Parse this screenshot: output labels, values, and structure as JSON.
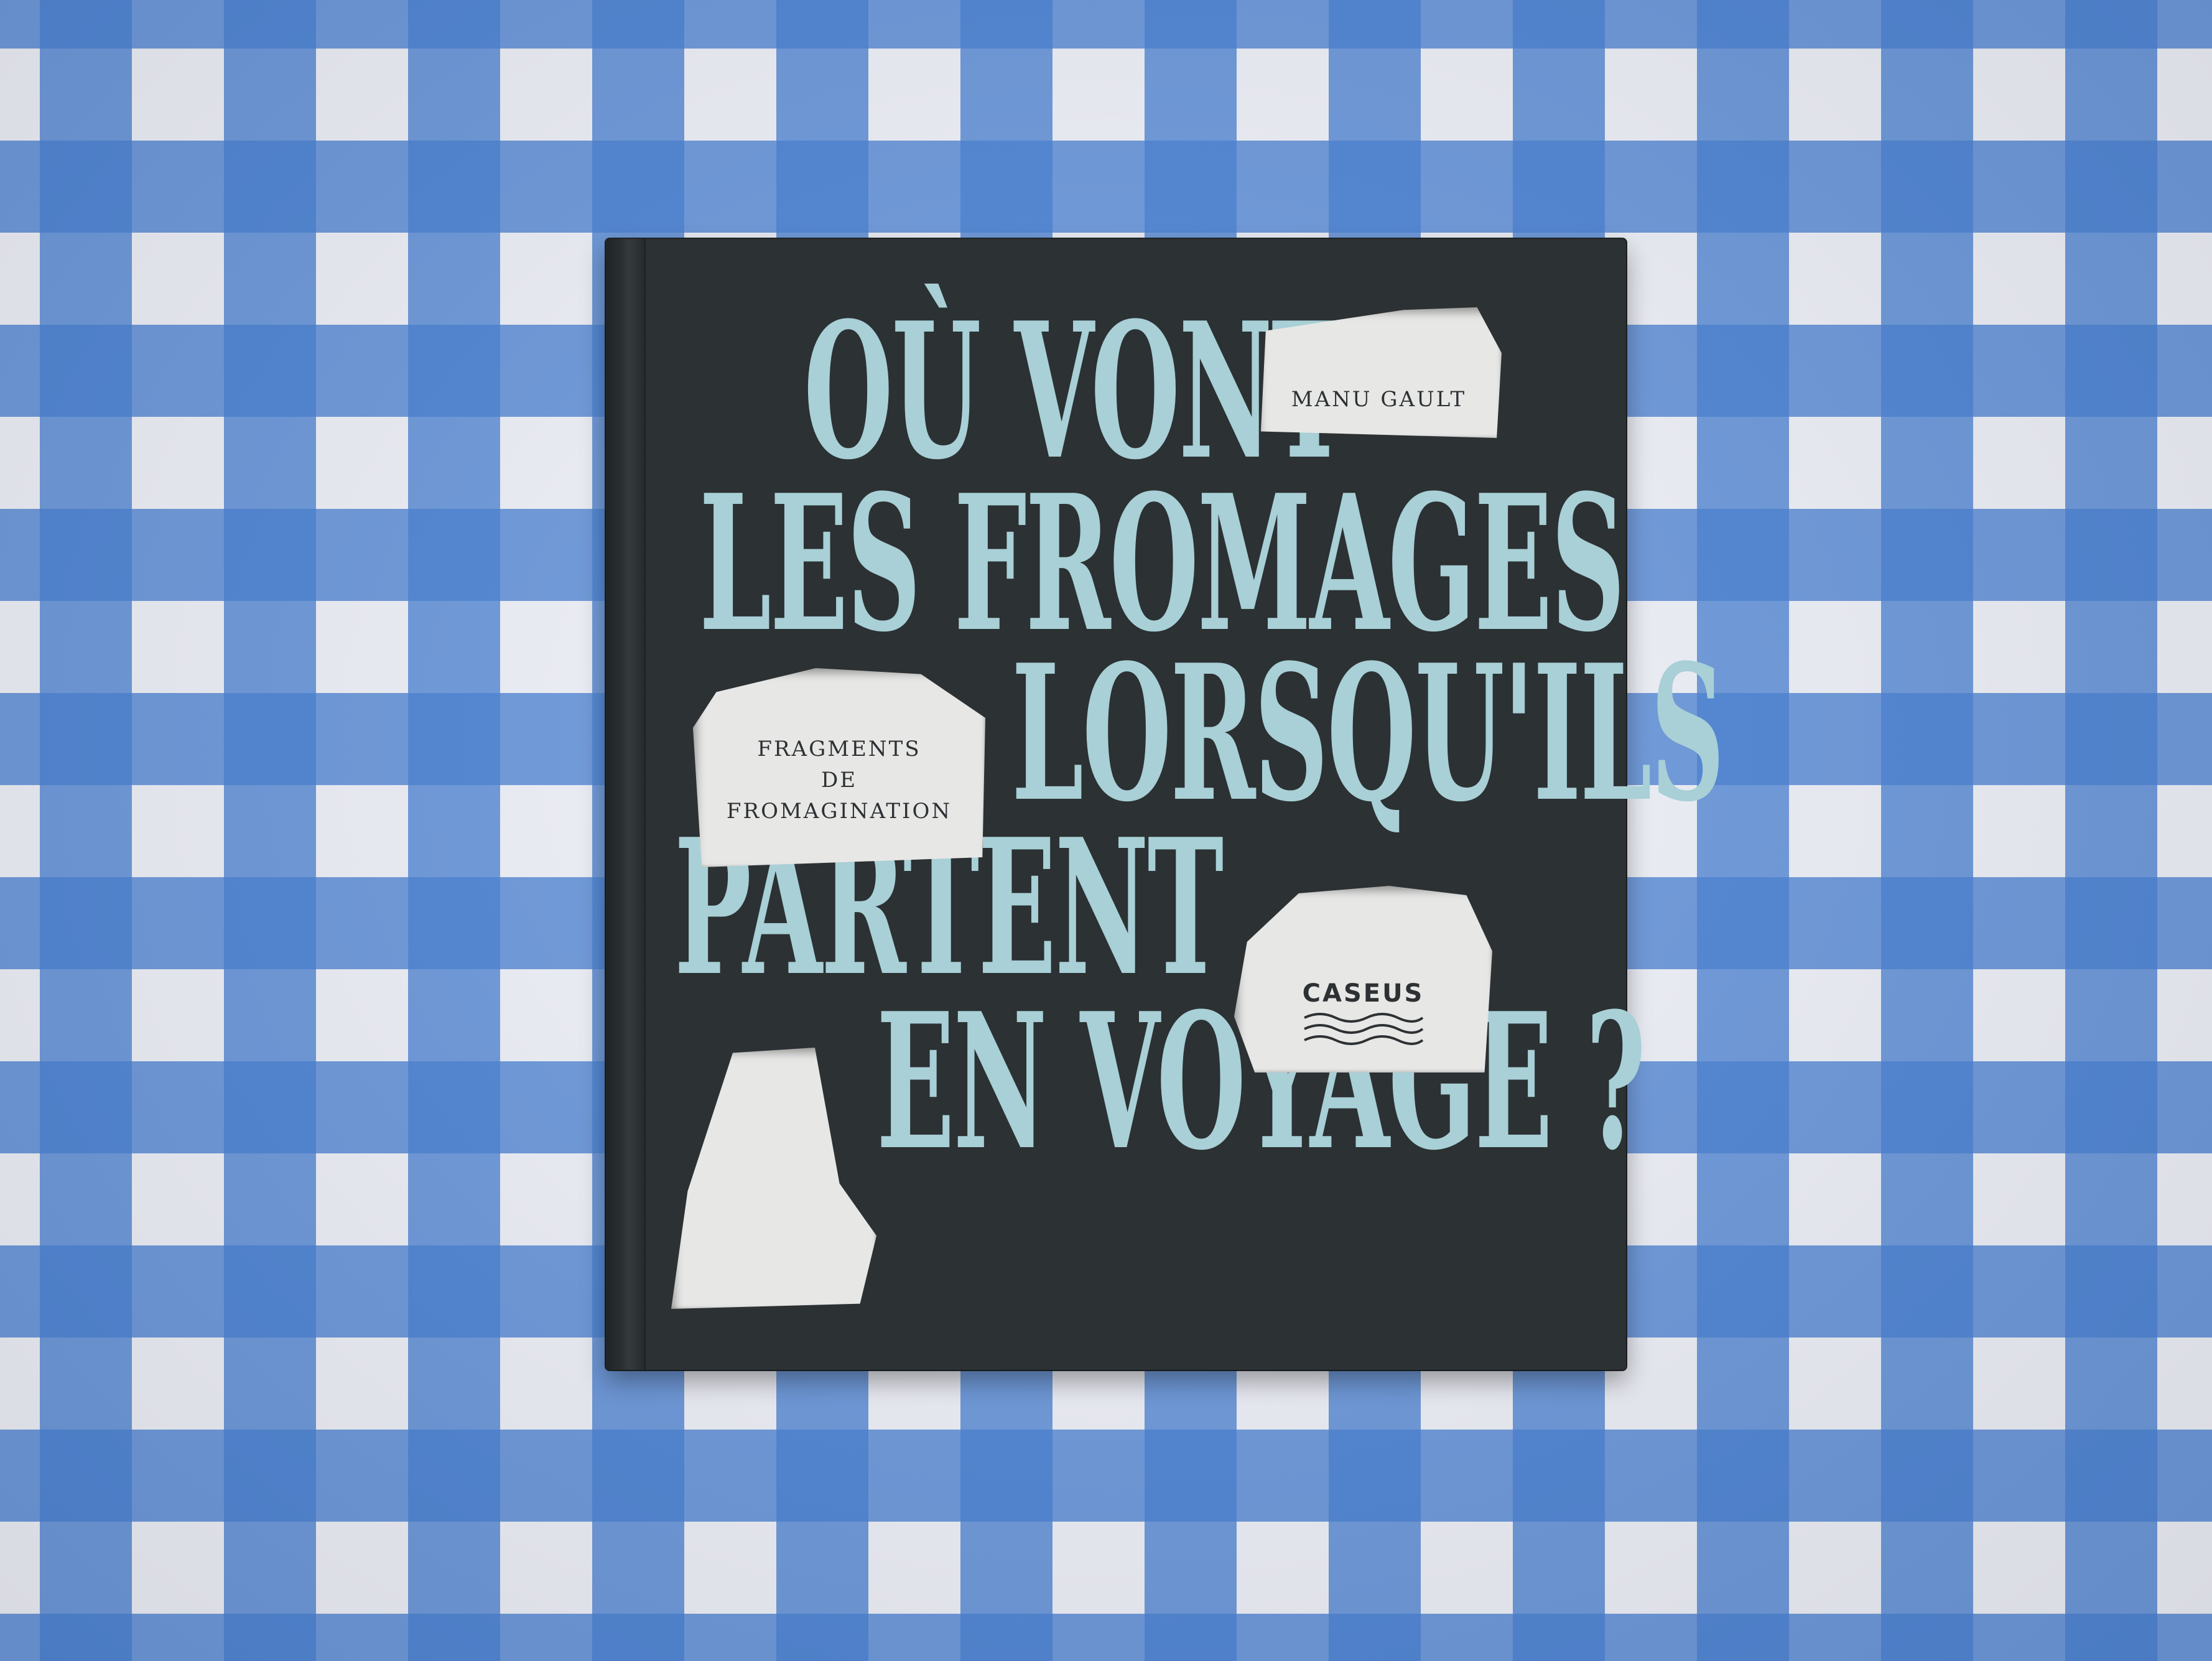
{
  "cover": {
    "title_lines": [
      "OÙ VONT",
      "LES FROMAGES",
      "LORSQU'ILS",
      "PARTENT",
      "EN VOYAGE ?"
    ],
    "author": "MANU GAULT",
    "subtitle_lines": [
      "FRAGMENTS",
      "DE",
      "FROMAGINATION"
    ],
    "publisher": "CASEUS"
  },
  "colors": {
    "cover": "#2c3133",
    "title": "#a8d0d6",
    "cutout": "#e7e7e6",
    "cloth_blue": "#4a83d6",
    "cloth_white": "#f1f3fb"
  }
}
